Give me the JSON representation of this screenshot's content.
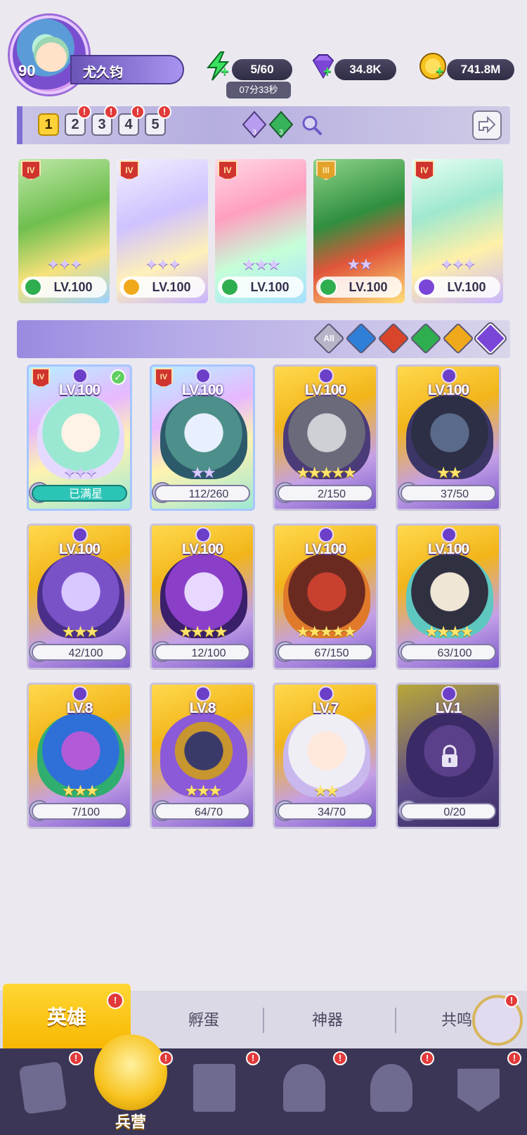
{
  "player": {
    "level": "90",
    "name": "尤久钧"
  },
  "resources": {
    "energy": "5/60",
    "energy_timer": "07分33秒",
    "gems": "34.8K",
    "gold": "741.8M"
  },
  "teams": {
    "tabs": [
      "1",
      "2",
      "3",
      "4",
      "5"
    ],
    "alert_glyph": "!",
    "gem_chip_1": "3",
    "gem_chip_2": "3"
  },
  "team_heroes": [
    {
      "rank": "IV",
      "level": "LV.100",
      "element": "green"
    },
    {
      "rank": "IV",
      "level": "LV.100",
      "element": "gold"
    },
    {
      "rank": "IV",
      "level": "LV.100",
      "element": "green"
    },
    {
      "rank": "III",
      "level": "LV.100",
      "element": "green"
    },
    {
      "rank": "IV",
      "level": "LV.100",
      "element": "purple"
    }
  ],
  "filters": {
    "all": "All"
  },
  "heroes": [
    {
      "level": "LV.100",
      "rank": "IV",
      "stars": "",
      "shards": "已满星",
      "full": true
    },
    {
      "level": "LV.100",
      "rank": "IV",
      "stars": "★★",
      "shards": "112/260"
    },
    {
      "level": "LV.100",
      "stars": "★★★★★",
      "shards": "2/150"
    },
    {
      "level": "LV.100",
      "stars": "★★",
      "shards": "37/50"
    },
    {
      "level": "LV.100",
      "stars": "★★★",
      "shards": "42/100"
    },
    {
      "level": "LV.100",
      "stars": "★★★★",
      "shards": "12/100"
    },
    {
      "level": "LV.100",
      "stars": "★★★★★",
      "shards": "67/150"
    },
    {
      "level": "LV.100",
      "stars": "★★★★",
      "shards": "63/100"
    },
    {
      "level": "LV.8",
      "stars": "★★★",
      "shards": "7/100"
    },
    {
      "level": "LV.8",
      "stars": "★★★",
      "shards": "64/70"
    },
    {
      "level": "LV.7",
      "stars": "★★",
      "shards": "34/70"
    },
    {
      "level": "LV.1",
      "stars": "",
      "shards": "0/20",
      "locked": true
    }
  ],
  "subtabs": {
    "active": "英雄",
    "hatch": "孵蛋",
    "artifact": "神器",
    "resonance": "共鸣"
  },
  "bottom_nav": {
    "barracks": "兵营"
  },
  "colors": {
    "accent_gold": "#f7b500",
    "accent_purple": "#7e6ed4",
    "alert_red": "#e23a3a",
    "elem_green": "#2fae4f",
    "elem_gold": "#f0a91a",
    "elem_purple": "#7a46d8",
    "elem_water": "#2f7fd8",
    "elem_fire": "#d8452a"
  }
}
